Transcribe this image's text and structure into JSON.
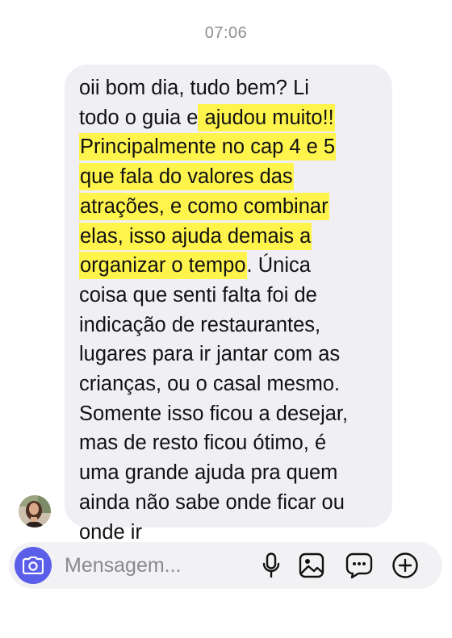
{
  "thread": {
    "timestamp": "07:06"
  },
  "message": {
    "lines": [
      {
        "plain_before": "oii bom dia, tudo bem? Li",
        "highlighted": "",
        "plain_after": ""
      },
      {
        "plain_before": "todo o guia e",
        "highlighted": " ajudou muito!!",
        "plain_after": ""
      },
      {
        "plain_before": "",
        "highlighted": "Principalmente no cap 4 e 5",
        "plain_after": ""
      },
      {
        "plain_before": "",
        "highlighted": "que fala do valores das",
        "plain_after": ""
      },
      {
        "plain_before": "",
        "highlighted": "atrações, e como combinar",
        "plain_after": ""
      },
      {
        "plain_before": "",
        "highlighted": "elas, isso ajuda demais a",
        "plain_after": ""
      },
      {
        "plain_before": "",
        "highlighted": "organizar o tempo",
        "plain_after": ". Única"
      },
      {
        "plain_before": "coisa que senti falta foi de",
        "highlighted": "",
        "plain_after": ""
      },
      {
        "plain_before": "indicação de restaurantes,",
        "highlighted": "",
        "plain_after": ""
      },
      {
        "plain_before": "lugares para ir jantar com as",
        "highlighted": "",
        "plain_after": ""
      },
      {
        "plain_before": "crianças, ou o casal mesmo.",
        "highlighted": "",
        "plain_after": ""
      },
      {
        "plain_before": "Somente isso ficou a desejar,",
        "highlighted": "",
        "plain_after": ""
      },
      {
        "plain_before": "mas de resto ficou ótimo, é",
        "highlighted": "",
        "plain_after": ""
      },
      {
        "plain_before": "uma grande ajuda pra quem",
        "highlighted": "",
        "plain_after": ""
      },
      {
        "plain_before": "ainda não sabe onde ficar ou",
        "highlighted": "",
        "plain_after": ""
      },
      {
        "plain_before": "onde ir",
        "highlighted": "",
        "plain_after": ""
      }
    ],
    "highlight_color": "#fff44c",
    "bubble_color": "#efeff4"
  },
  "composer": {
    "placeholder": "Mensagem...",
    "value": "",
    "camera_icon": "camera-icon",
    "accent_color": "#5b5ee8",
    "tools": [
      {
        "name": "microphone-icon"
      },
      {
        "name": "image-icon"
      },
      {
        "name": "sticker-icon"
      },
      {
        "name": "add-icon"
      }
    ]
  }
}
